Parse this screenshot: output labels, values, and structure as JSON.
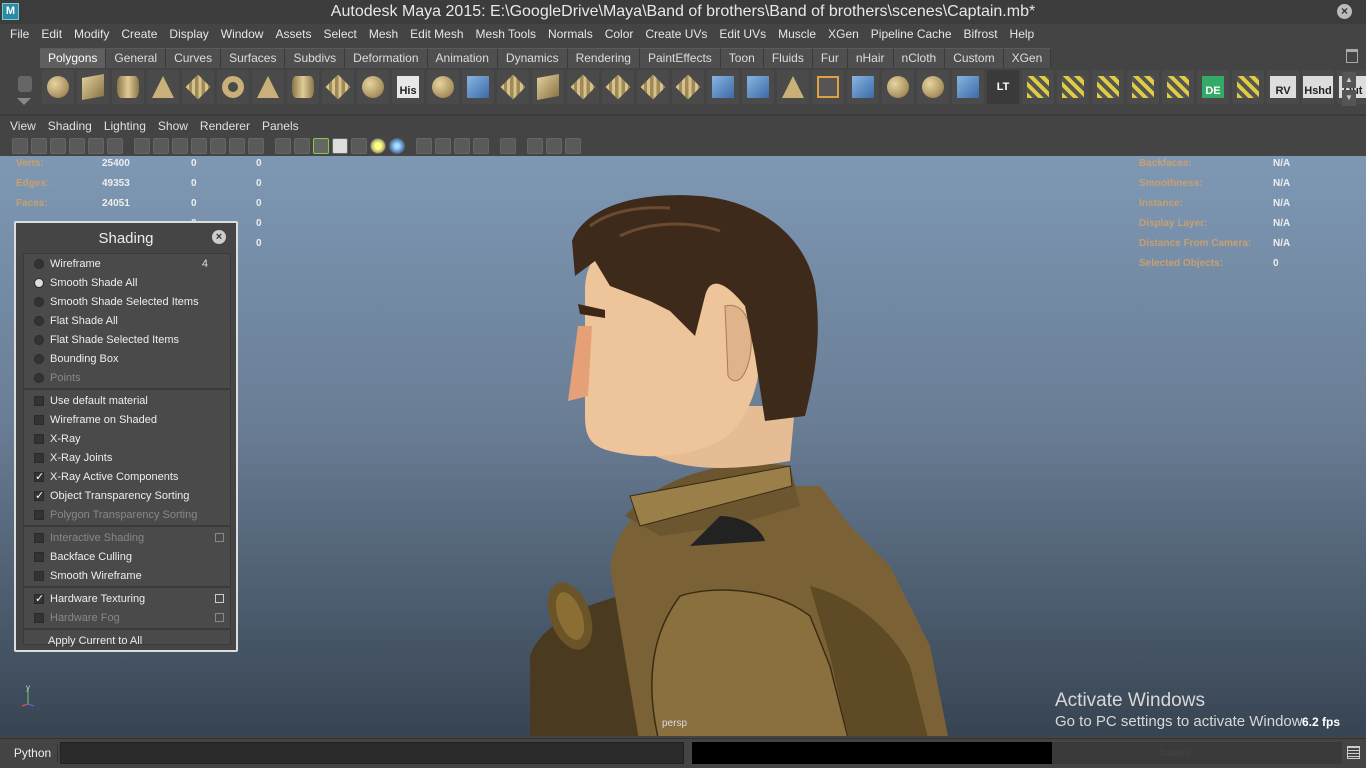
{
  "window": {
    "title": "Autodesk Maya 2015: E:\\GoogleDrive\\Maya\\Band of brothers\\Band of brothers\\scenes\\Captain.mb*",
    "app_icon": "M"
  },
  "menubar": [
    "File",
    "Edit",
    "Modify",
    "Create",
    "Display",
    "Window",
    "Assets",
    "Select",
    "Mesh",
    "Edit Mesh",
    "Mesh Tools",
    "Normals",
    "Color",
    "Create UVs",
    "Edit UVs",
    "Muscle",
    "XGen",
    "Pipeline Cache",
    "Bifrost",
    "Help"
  ],
  "shelf_tabs": [
    "Polygons",
    "General",
    "Curves",
    "Surfaces",
    "Subdivs",
    "Deformation",
    "Animation",
    "Dynamics",
    "Rendering",
    "PaintEffects",
    "Toon",
    "Fluids",
    "Fur",
    "nHair",
    "nCloth",
    "Custom",
    "XGen"
  ],
  "shelf_tabs_active": "Polygons",
  "shelf_buttons": {
    "his": "His",
    "lt": "LT",
    "de": "DE",
    "rv": "RV",
    "hshd": "Hshd",
    "out": "Out"
  },
  "panel_menu": [
    "View",
    "Shading",
    "Lighting",
    "Show",
    "Renderer",
    "Panels"
  ],
  "hud_left": [
    {
      "label": "Verts:",
      "v1": "25400",
      "v2": "0",
      "v3": "0"
    },
    {
      "label": "Edges:",
      "v1": "49353",
      "v2": "0",
      "v3": "0"
    },
    {
      "label": "Faces:",
      "v1": "24051",
      "v2": "0",
      "v3": "0"
    },
    {
      "label": "",
      "v1": "",
      "v2": "0",
      "v3": "0"
    },
    {
      "label": "",
      "v1": "",
      "v2": "",
      "v3": "0"
    }
  ],
  "hud_right": [
    {
      "label": "Backfaces:",
      "value": "N/A"
    },
    {
      "label": "Smoothness:",
      "value": "N/A"
    },
    {
      "label": "Instance:",
      "value": "N/A"
    },
    {
      "label": "Display Layer:",
      "value": "N/A"
    },
    {
      "label": "Distance From Camera:",
      "value": "N/A"
    },
    {
      "label": "Selected Objects:",
      "value": "0"
    }
  ],
  "shading_panel": {
    "title": "Shading",
    "radio_items": [
      {
        "label": "Wireframe",
        "checked": false,
        "hotkey": "4",
        "disabled": false
      },
      {
        "label": "Smooth Shade All",
        "checked": true,
        "hotkey": "",
        "disabled": false
      },
      {
        "label": "Smooth Shade Selected Items",
        "checked": false,
        "hotkey": "",
        "disabled": false
      },
      {
        "label": "Flat Shade All",
        "checked": false,
        "hotkey": "",
        "disabled": false
      },
      {
        "label": "Flat Shade Selected Items",
        "checked": false,
        "hotkey": "",
        "disabled": false
      },
      {
        "label": "Bounding Box",
        "checked": false,
        "hotkey": "",
        "disabled": false
      },
      {
        "label": "Points",
        "checked": false,
        "hotkey": "",
        "disabled": true
      }
    ],
    "check_items_1": [
      {
        "label": "Use default material",
        "checked": false,
        "disabled": false
      },
      {
        "label": "Wireframe on Shaded",
        "checked": false,
        "disabled": false
      },
      {
        "label": "X-Ray",
        "checked": false,
        "disabled": false
      },
      {
        "label": "X-Ray Joints",
        "checked": false,
        "disabled": false
      },
      {
        "label": "X-Ray Active Components",
        "checked": true,
        "disabled": false
      },
      {
        "label": "Object Transparency Sorting",
        "checked": true,
        "disabled": false
      },
      {
        "label": "Polygon Transparency Sorting",
        "checked": false,
        "disabled": true
      }
    ],
    "check_items_2": [
      {
        "label": "Interactive Shading",
        "checked": false,
        "disabled": true,
        "option_box": true
      },
      {
        "label": "Backface Culling",
        "checked": false,
        "disabled": false,
        "option_box": false
      },
      {
        "label": "Smooth Wireframe",
        "checked": false,
        "disabled": false,
        "option_box": false
      }
    ],
    "check_items_3": [
      {
        "label": "Hardware Texturing",
        "checked": true,
        "disabled": false,
        "option_box": true
      },
      {
        "label": "Hardware Fog",
        "checked": false,
        "disabled": true,
        "option_box": true
      }
    ],
    "apply_label": "Apply Current to All"
  },
  "viewport": {
    "camera": "persp",
    "fps": "6.2 fps",
    "axis_label": "y"
  },
  "activate_windows": {
    "line1": "Activate Windows",
    "line2": "Go to PC settings to activate Window"
  },
  "command_line": {
    "language": "Python",
    "right_text": "trades"
  }
}
